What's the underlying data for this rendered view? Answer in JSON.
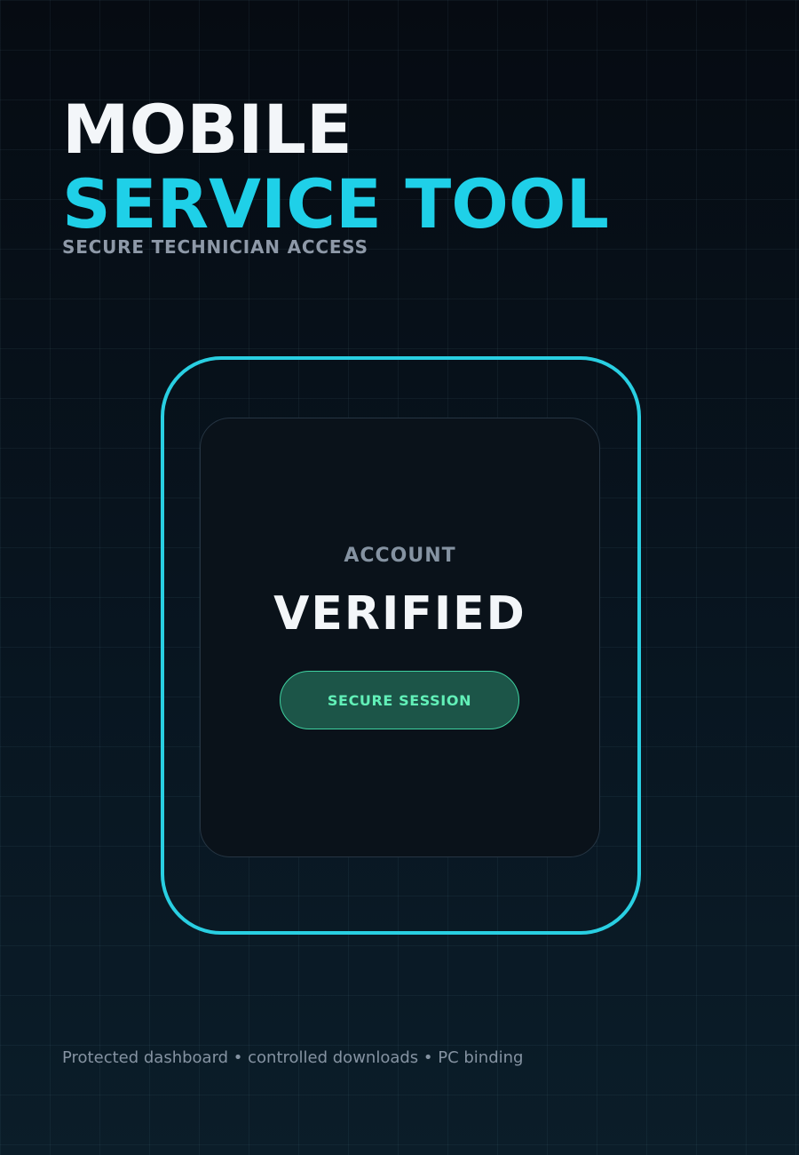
{
  "header": {
    "title_line_1": "MOBILE",
    "title_line_2": "SERVICE TOOL",
    "subtitle": "SECURE TECHNICIAN ACCESS"
  },
  "status_card": {
    "label": "ACCOUNT",
    "status": "VERIFIED",
    "session_button_label": "SECURE SESSION"
  },
  "footer": {
    "text": "Protected dashboard • controlled downloads • PC binding"
  },
  "colors": {
    "accent": "#1fd0e8",
    "frame": "#29cfe2",
    "success_text": "#62f0b8",
    "success_bg": "#1c5548"
  }
}
